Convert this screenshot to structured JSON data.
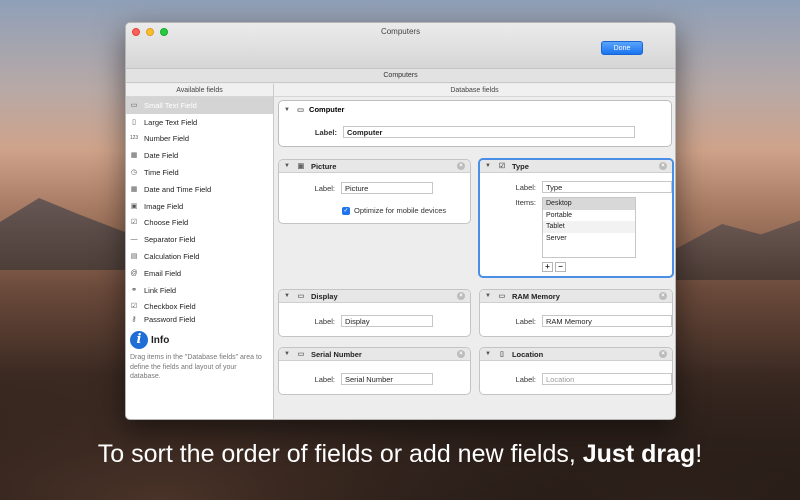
{
  "window": {
    "title": "Computers",
    "done_label": "Done",
    "subtitle": "Computers"
  },
  "left_pane": {
    "header": "Available fields",
    "items": [
      {
        "label": "Small Text Field",
        "icon": "text-field-icon"
      },
      {
        "label": "Large Text Field",
        "icon": "document-icon"
      },
      {
        "label": "Number Field",
        "icon": "number-icon"
      },
      {
        "label": "Date Field",
        "icon": "calendar-icon"
      },
      {
        "label": "Time Field",
        "icon": "clock-icon"
      },
      {
        "label": "Date and Time Field",
        "icon": "calendar-clock-icon"
      },
      {
        "label": "Image Field",
        "icon": "image-icon"
      },
      {
        "label": "Choose Field",
        "icon": "checklist-icon"
      },
      {
        "label": "Separator Field",
        "icon": "separator-icon"
      },
      {
        "label": "Calculation Field",
        "icon": "calculator-icon"
      },
      {
        "label": "Email Field",
        "icon": "at-icon"
      },
      {
        "label": "Link Field",
        "icon": "link-icon"
      },
      {
        "label": "Checkbox Field",
        "icon": "checkbox-icon"
      },
      {
        "label": "Password Field",
        "icon": "key-icon"
      }
    ],
    "info": {
      "title": "Info",
      "text": "Drag items in the \"Database fields\" area to define the fields and layout of your database."
    }
  },
  "right_pane": {
    "header": "Database fields",
    "computer": {
      "title": "Computer",
      "label_caption": "Label:",
      "label_value": "Computer"
    },
    "picture": {
      "title": "Picture",
      "label_caption": "Label:",
      "label_value": "Picture",
      "checkbox_label": "Optimize for mobile devices"
    },
    "type": {
      "title": "Type",
      "label_caption": "Label:",
      "label_value": "Type",
      "items_caption": "Items:",
      "items": [
        "Desktop",
        "Portable",
        "Tablet",
        "Server"
      ],
      "add": "+",
      "remove": "−"
    },
    "display": {
      "title": "Display",
      "label_caption": "Label:",
      "label_value": "Display"
    },
    "ram": {
      "title": "RAM Memory",
      "label_caption": "Label:",
      "label_value": "RAM Memory"
    },
    "serial": {
      "title": "Serial Number",
      "label_caption": "Label:",
      "label_value": "Serial Number"
    },
    "location": {
      "title": "Location",
      "label_caption": "Label:",
      "label_placeholder": "Location"
    }
  },
  "caption": {
    "text": "To sort the order of fields or add new fields, ",
    "bold": "Just drag",
    "end": "!"
  }
}
